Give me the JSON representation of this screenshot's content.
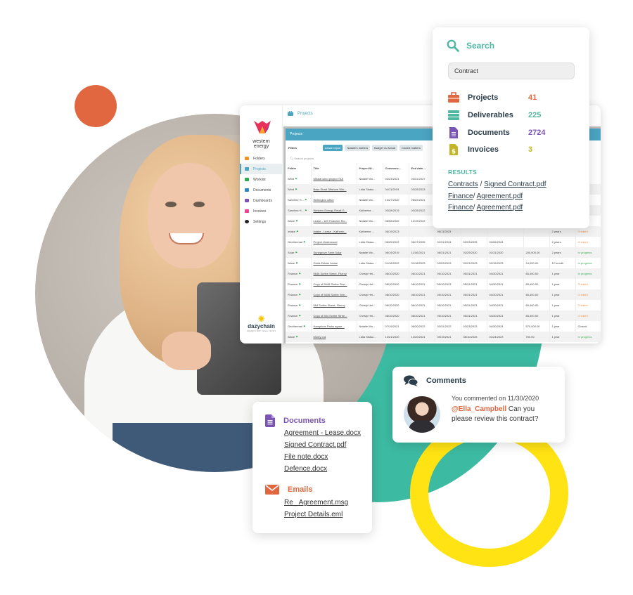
{
  "colors": {
    "teal": "#3dbaa2",
    "orange": "#e0673f",
    "yellow": "#ffe313",
    "app_accent": "#4aa5c2",
    "purple": "#7b55b5",
    "navy": "#2b3d4a"
  },
  "app": {
    "brand_line1": "western",
    "brand_line2": "energy",
    "breadcrumb": "Projects",
    "sidebar": [
      {
        "label": "Folders",
        "icon": "folder-icon",
        "color": "#f0932b"
      },
      {
        "label": "Projects",
        "icon": "briefcase-icon",
        "color": "#4aa5c2",
        "active": true
      },
      {
        "label": "Worklist",
        "icon": "list-icon",
        "color": "#2fa84f"
      },
      {
        "label": "Documents",
        "icon": "document-icon",
        "color": "#2e86c1"
      },
      {
        "label": "Dashboards",
        "icon": "chart-icon",
        "color": "#7b55b5"
      },
      {
        "label": "Invoices",
        "icon": "dollar-icon",
        "color": "#e84393"
      },
      {
        "label": "Settings",
        "icon": "gear-icon",
        "color": "#222222"
      }
    ],
    "footer_brand": "dazychain",
    "footer_copy": "Copyright © 2023 · Version 1.23.18.1",
    "panel_title": "Projects",
    "filters_label": "Filters",
    "filters": [
      "Lease report",
      "Natalie's matters",
      "Budget vs Actual",
      "Closed matters"
    ],
    "search_placeholder": "Search projects",
    "columns": [
      "Folder",
      "Title",
      "Project M...",
      "Commenc...",
      "End date ...",
      "",
      "",
      "",
      "",
      "",
      ""
    ],
    "rows": [
      [
        "Wind",
        "Mistral wind project TAS",
        "Natalie Wo...",
        "02/23/2021",
        "03/31/2027",
        "",
        "",
        "",
        "",
        "",
        ""
      ],
      [
        "Wind",
        "Bass Strait Offshore Win...",
        "Lidia Strasc...",
        "04/11/2019",
        "03/28/2023",
        "",
        "",
        "",
        "",
        "",
        ""
      ],
      [
        "Sanchez H...",
        "Wellington office",
        "Natalie Wo...",
        "10/27/2020",
        "06/22/2021",
        "",
        "",
        "",
        "",
        "",
        ""
      ],
      [
        "Sanchez H...",
        "Western Energy Retail G...",
        "Katherine ...",
        "03/28/2019",
        "03/28/2022",
        "",
        "",
        "",
        "",
        "",
        ""
      ],
      [
        "Wave",
        "Lease - 120 Thatcher Ro...",
        "Natalie Wo...",
        "08/06/2020",
        "12/19/2022",
        "",
        "",
        "",
        "",
        "",
        ""
      ],
      [
        "Intake",
        "Intake - Lease - Katherin...",
        "Katherine ...",
        "06/19/2023",
        "",
        "06/11/2023",
        "",
        "",
        "",
        "2 years",
        "Created"
      ],
      [
        "Geothermal",
        "Project Underwood",
        "Lidia Strasc...",
        "06/25/2022",
        "06/17/2025",
        "01/31/2024",
        "02/03/2025",
        "02/06/2024",
        "",
        "2 years",
        "Created"
      ],
      [
        "Solar",
        "Sunegrove Farm Solar",
        "Natalie Wo...",
        "06/19/2019",
        "11/30/2021",
        "08/31/2021",
        "02/29/2020",
        "01/31/2020",
        "200,000.00",
        "2 years",
        "In progress"
      ],
      [
        "Wave",
        "Greta Estate Lease",
        "Lidia Strasc...",
        "01/18/2022",
        "01/18/2023",
        "03/29/2023",
        "02/21/2023",
        "02/15/2023",
        "24,000.00",
        "12 month",
        "In progress"
      ],
      [
        "Finance",
        "5646 Scribe Street, Fitzroy",
        "Christy Hel...",
        "08/10/2020",
        "08/10/2021",
        "05/10/2021",
        "05/31/2021",
        "04/30/2021",
        "65,400.00",
        "1 year",
        "In progress"
      ],
      [
        "Finance",
        "Copy of 5646 Scribe Stre...",
        "Christy Hel...",
        "08/10/2020",
        "08/10/2021",
        "05/10/2021",
        "05/31/2021",
        "04/30/2021",
        "65,400.00",
        "1 year",
        "Created"
      ],
      [
        "Finance",
        "Copy of 5646 Scribe Stre...",
        "Christy Hel...",
        "08/10/2020",
        "08/10/2021",
        "05/10/2021",
        "05/31/2021",
        "04/30/2021",
        "65,400.00",
        "1 year",
        "Created"
      ],
      [
        "Finance",
        "564 Scribe Street, Fitzroy",
        "Christy Hel...",
        "08/10/2020",
        "08/10/2021",
        "05/10/2021",
        "05/31/2021",
        "04/30/2021",
        "65,400.00",
        "1 year",
        "Created"
      ],
      [
        "Finance",
        "Copy of 564 Scribe Stree...",
        "Christy Hel...",
        "08/10/2020",
        "08/10/2021",
        "05/10/2021",
        "05/31/2021",
        "04/30/2021",
        "65,400.00",
        "1 year",
        "Created"
      ],
      [
        "Geothermal",
        "Hamptons Parks agree...",
        "Natalie Wo...",
        "07/19/2021",
        "06/30/2022",
        "03/31/2022",
        "03/23/2023",
        "04/30/2024",
        "570,000.00",
        "1 year",
        "Closed"
      ],
      [
        "Wave",
        "Monty Ltd",
        "Lidia Strasc...",
        "12/21/2020",
        "12/20/2021",
        "09/19/2021",
        "06/10/2025",
        "01/24/2023",
        "750.00",
        "1 year",
        "In progress"
      ]
    ]
  },
  "search_card": {
    "title": "Search",
    "query": "Contract",
    "categories": [
      {
        "label": "Projects",
        "count": "41",
        "icon": "briefcase-icon",
        "color": "#e0673f"
      },
      {
        "label": "Deliverables",
        "count": "225",
        "icon": "server-stack-icon",
        "color": "#4fb8a3"
      },
      {
        "label": "Documents",
        "count": "2724",
        "icon": "document-icon",
        "color": "#7b55b5"
      },
      {
        "label": "Invoices",
        "count": "3",
        "icon": "invoice-dollar-icon",
        "color": "#c2b526"
      }
    ],
    "results_heading": "RESULTS",
    "results": [
      {
        "folder": "Contracts",
        "sep": " / ",
        "file": "Signed Contract.pdf"
      },
      {
        "folder": "Finance",
        "sep": "/ ",
        "file": "Agreement.pdf"
      },
      {
        "folder": "Finance",
        "sep": "/ ",
        "file": "Agreement.pdf"
      }
    ]
  },
  "comments_card": {
    "title": "Comments",
    "meta": "You commented on 11/30/2020",
    "mention": "@Ella_Campbell",
    "message": " Can you please review this contract?"
  },
  "docs_card": {
    "documents_title": "Documents",
    "documents": [
      "Agreement - Lease.docx",
      "Signed Contract.pdf",
      "File note.docx",
      "Defence.docx"
    ],
    "emails_title": "Emails",
    "emails": [
      "Re_ Agreement.msg",
      "Project Details.eml"
    ]
  }
}
